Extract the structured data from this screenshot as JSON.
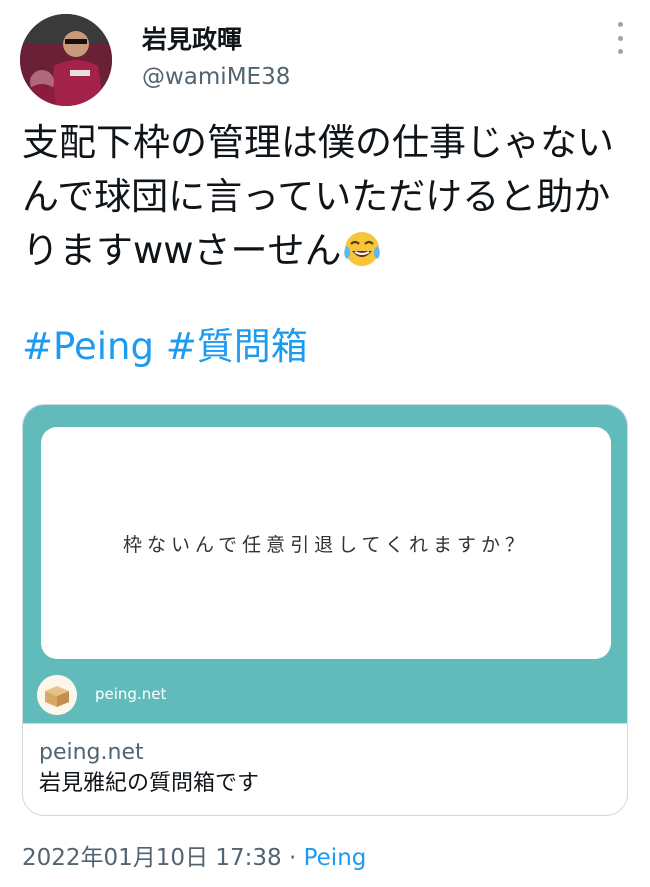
{
  "user": {
    "display_name": "岩見政暉",
    "handle": "@wamiME38"
  },
  "tweet": {
    "text": "支配下枠の管理は僕の仕事じゃないんで球団に言っていただけると助かりますwwさーせん",
    "emoji": "face-with-tears-of-joy",
    "hashtags": [
      "#Peing",
      "#質問箱"
    ]
  },
  "card": {
    "question": "枠ないんで任意引退してくれますか？",
    "image_site_label": "peing.net",
    "domain": "peing.net",
    "title": "岩見雅紀の質問箱です"
  },
  "meta": {
    "timestamp": "2022年01月10日 17:38",
    "separator": "·",
    "source": "Peing"
  },
  "colors": {
    "accent": "#1d9bf0",
    "card_teal": "#62bbbb",
    "secondary_text": "#536471"
  }
}
